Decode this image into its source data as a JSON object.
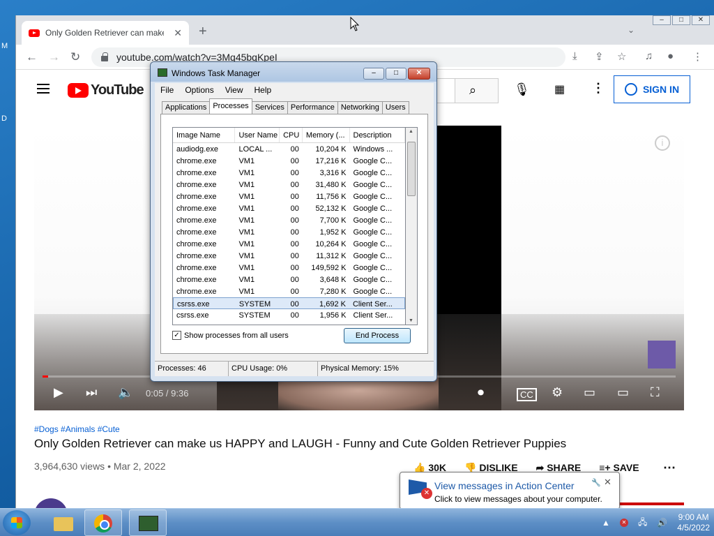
{
  "desktop": {
    "side_letters": [
      "M",
      "D"
    ]
  },
  "chrome": {
    "tab_title": "Only Golden Retriever can make",
    "url": "youtube.com/watch?v=3Mq45bqKpeI"
  },
  "youtube": {
    "logo_text": "YouTube",
    "signin_label": "SIGN IN",
    "video_time": "0:05 / 9:36",
    "progress_fraction": 0.009,
    "hashtags": "#Dogs #Animals #Cute",
    "title": "Only Golden Retriever can make us HAPPY and LAUGH - Funny and Cute Golden Retriever Puppies",
    "views": "3,964,630 views • Mar 2, 2022",
    "actions": {
      "like": "30K",
      "dislike": "DISLIKE",
      "share": "SHARE",
      "save": "SAVE"
    }
  },
  "task_manager": {
    "title": "Windows Task Manager",
    "menu": [
      "File",
      "Options",
      "View",
      "Help"
    ],
    "tabs": [
      "Applications",
      "Processes",
      "Services",
      "Performance",
      "Networking",
      "Users"
    ],
    "active_tab": "Processes",
    "columns": [
      "Image Name",
      "User Name",
      "CPU",
      "Memory (...",
      "Description"
    ],
    "rows": [
      [
        "audiodg.exe",
        "LOCAL ...",
        "00",
        "10,204 K",
        "Windows ..."
      ],
      [
        "chrome.exe",
        "VM1",
        "00",
        "17,216 K",
        "Google C..."
      ],
      [
        "chrome.exe",
        "VM1",
        "00",
        "3,316 K",
        "Google C..."
      ],
      [
        "chrome.exe",
        "VM1",
        "00",
        "31,480 K",
        "Google C..."
      ],
      [
        "chrome.exe",
        "VM1",
        "00",
        "11,756 K",
        "Google C..."
      ],
      [
        "chrome.exe",
        "VM1",
        "00",
        "52,132 K",
        "Google C..."
      ],
      [
        "chrome.exe",
        "VM1",
        "00",
        "7,700 K",
        "Google C..."
      ],
      [
        "chrome.exe",
        "VM1",
        "00",
        "1,952 K",
        "Google C..."
      ],
      [
        "chrome.exe",
        "VM1",
        "00",
        "10,264 K",
        "Google C..."
      ],
      [
        "chrome.exe",
        "VM1",
        "00",
        "11,312 K",
        "Google C..."
      ],
      [
        "chrome.exe",
        "VM1",
        "00",
        "149,592 K",
        "Google C..."
      ],
      [
        "chrome.exe",
        "VM1",
        "00",
        "3,648 K",
        "Google C..."
      ],
      [
        "chrome.exe",
        "VM1",
        "00",
        "7,280 K",
        "Google C..."
      ],
      [
        "csrss.exe",
        "SYSTEM",
        "00",
        "1,692 K",
        "Client Ser..."
      ],
      [
        "csrss.exe",
        "SYSTEM",
        "00",
        "1,956 K",
        "Client Ser..."
      ]
    ],
    "selected_row": 13,
    "show_all_label": "Show processes from all users",
    "show_all_checked": true,
    "end_process_label": "End Process",
    "status": {
      "processes": "Processes: 46",
      "cpu": "CPU Usage: 0%",
      "memory": "Physical Memory: 15%"
    }
  },
  "balloon": {
    "title": "View messages in Action Center",
    "text": "Click to view messages about your computer."
  },
  "taskbar": {
    "time": "9:00 AM",
    "date": "4/5/2022"
  }
}
